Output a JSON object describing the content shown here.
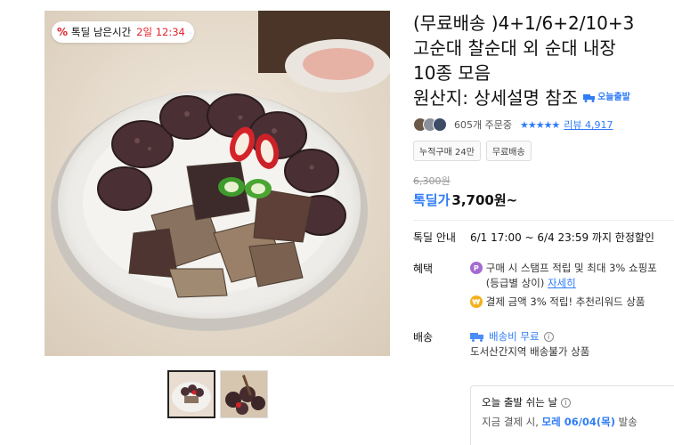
{
  "timer": {
    "icon": "discount-percent-icon",
    "label": "톡딜 남은시간",
    "value": "2일 12:34"
  },
  "product": {
    "title_lines": [
      "(무료배송 )4+1/6+2/10+3",
      "고순대 찰순대 외 순대 내장",
      "10종 모음"
    ],
    "origin": "원산지: 상세설명 참조",
    "today_ship": "오늘출발"
  },
  "review": {
    "orders": "605개 주문중",
    "stars": "★★★★★",
    "review_link": "리뷰 4,917"
  },
  "tags": [
    "누적구매 24만",
    "무료배송"
  ],
  "price": {
    "original": "6,300원",
    "deal_label": "톡딜가",
    "deal_price": "3,700원~"
  },
  "deal_info": {
    "key": "톡딜 안내",
    "value": "6/1 17:00 ~ 6/4 23:59 까지 한정할인"
  },
  "benefit": {
    "key": "혜택",
    "line1": "구매 시 스탬프 적립 및 최대 3% 쇼핑포",
    "line1_sub": "(등급별 상이)",
    "detail_link": "자세히",
    "line2": "결제 금액 3% 적립! 추천리워드 상품"
  },
  "shipping": {
    "key": "배송",
    "fee": "배송비 무료",
    "note": "도서산간지역 배송불가 상품"
  },
  "holiday": {
    "title": "오늘 출발 쉬는 날",
    "note_prefix": "지금 결제 시,",
    "date": "모레 06/04(목)",
    "note_suffix": "발송"
  },
  "colors": {
    "accent_blue": "#2f7cf6",
    "deal_red": "#e4222e"
  }
}
